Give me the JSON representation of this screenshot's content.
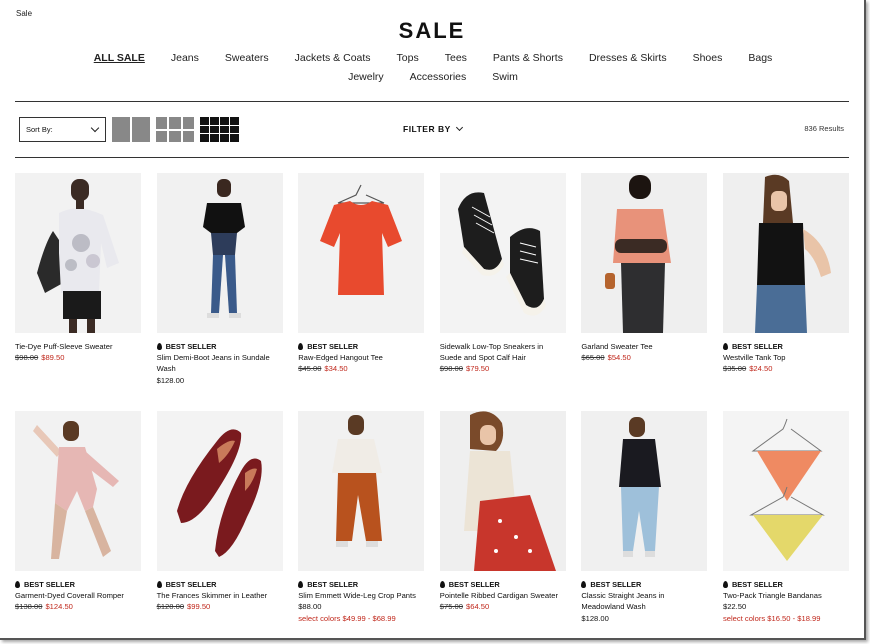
{
  "breadcrumb": "Sale",
  "page_title": "SALE",
  "nav": {
    "row1": [
      "ALL SALE",
      "Jeans",
      "Sweaters",
      "Jackets & Coats",
      "Tops",
      "Tees",
      "Pants & Shorts",
      "Dresses & Skirts",
      "Shoes",
      "Bags"
    ],
    "row2": [
      "Jewelry",
      "Accessories",
      "Swim"
    ]
  },
  "toolbar": {
    "sort_label": "Sort By:",
    "filter_label": "FILTER BY",
    "results": "836 Results"
  },
  "products": [
    {
      "best": "",
      "name": "Tie-Dye Puff-Sleeve Sweater",
      "old": "$98.00",
      "price": "$89.50",
      "colors": ""
    },
    {
      "best": "BEST SELLER",
      "name": "Slim Demi-Boot Jeans in Sundale Wash",
      "old": "",
      "price": "$128.00",
      "colors": ""
    },
    {
      "best": "BEST SELLER",
      "name": "Raw-Edged Hangout Tee",
      "old": "$45.00",
      "price": "$34.50",
      "colors": ""
    },
    {
      "best": "",
      "name": "Sidewalk Low-Top Sneakers in Suede and Spot Calf Hair",
      "old": "$98.00",
      "price": "$79.50",
      "colors": ""
    },
    {
      "best": "",
      "name": "Garland Sweater Tee",
      "old": "$65.00",
      "price": "$54.50",
      "colors": ""
    },
    {
      "best": "BEST SELLER",
      "name": "Westville Tank Top",
      "old": "$35.00",
      "price": "$24.50",
      "colors": ""
    },
    {
      "best": "BEST SELLER",
      "name": "Garment-Dyed Coverall Romper",
      "old": "$138.00",
      "price": "$124.50",
      "colors": ""
    },
    {
      "best": "BEST SELLER",
      "name": "The Frances Skimmer in Leather",
      "old": "$128.00",
      "price": "$99.50",
      "colors": ""
    },
    {
      "best": "BEST SELLER",
      "name": "Slim Emmett Wide-Leg Crop Pants",
      "old": "",
      "price": "$88.00",
      "colors": "select colors $49.99 - $68.99"
    },
    {
      "best": "BEST SELLER",
      "name": "Pointelle Ribbed Cardigan Sweater",
      "old": "$75.00",
      "price": "$64.50",
      "colors": ""
    },
    {
      "best": "BEST SELLER",
      "name": "Classic Straight Jeans in Meadowland Wash",
      "old": "",
      "price": "$128.00",
      "colors": ""
    },
    {
      "best": "BEST SELLER",
      "name": "Two-Pack Triangle Bandanas",
      "old": "",
      "price": "$22.50",
      "colors": "select colors $16.50 - $18.99"
    }
  ],
  "colors": {
    "sale_red": "#c0281c",
    "image_bg": "#efefef"
  }
}
